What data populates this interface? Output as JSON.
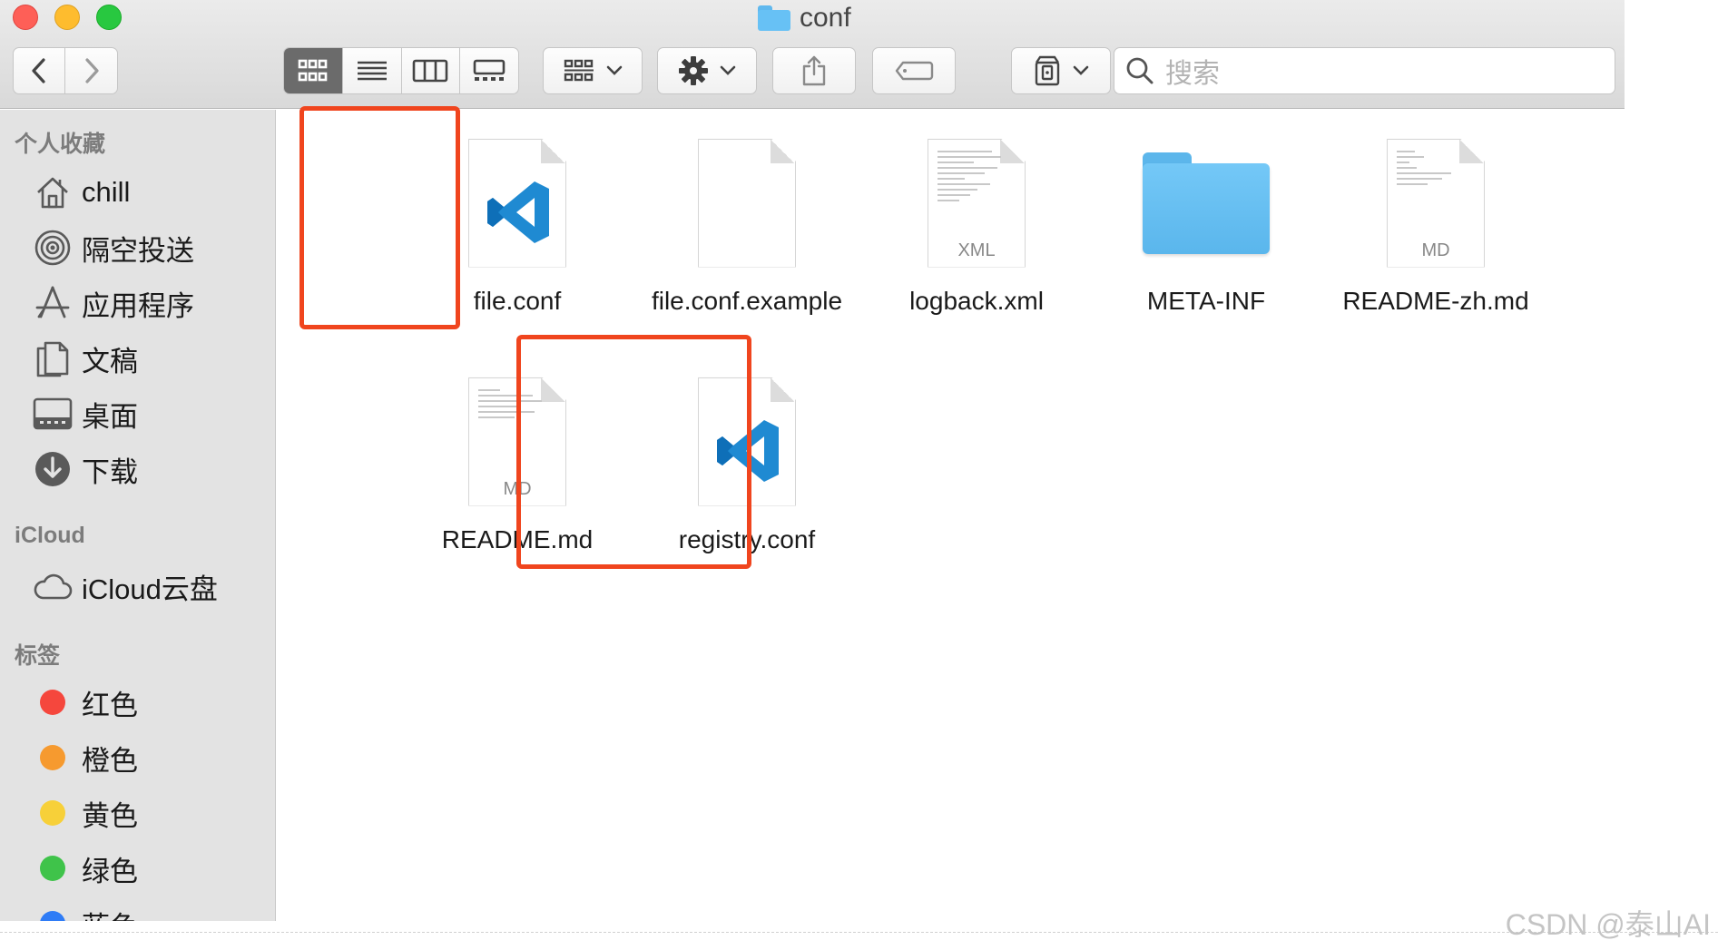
{
  "window": {
    "title": "conf"
  },
  "toolbar": {
    "back_icon": "chevron-left-icon",
    "forward_icon": "chevron-right-icon",
    "view_modes": [
      "icon-view",
      "list-view",
      "column-view",
      "gallery-view"
    ],
    "active_view": "icon-view",
    "search_placeholder": "搜索"
  },
  "sidebar": {
    "favorites_header": "个人收藏",
    "favorites": [
      {
        "label": "chill",
        "icon": "home-icon"
      },
      {
        "label": "隔空投送",
        "icon": "airdrop-icon"
      },
      {
        "label": "应用程序",
        "icon": "applications-icon"
      },
      {
        "label": "文稿",
        "icon": "documents-icon"
      },
      {
        "label": "桌面",
        "icon": "desktop-icon"
      },
      {
        "label": "下载",
        "icon": "download-icon"
      }
    ],
    "icloud_header": "iCloud",
    "icloud": [
      {
        "label": "iCloud云盘",
        "icon": "cloud-icon"
      }
    ],
    "tags_header": "标签",
    "tags": [
      {
        "label": "红色",
        "color": "#f5473d"
      },
      {
        "label": "橙色",
        "color": "#f69a2f"
      },
      {
        "label": "黄色",
        "color": "#f7d039"
      },
      {
        "label": "绿色",
        "color": "#3fc34a"
      },
      {
        "label": "蓝色",
        "color": "#2f7cf6"
      }
    ]
  },
  "files": [
    {
      "name": "file.conf",
      "kind": "vscode",
      "highlighted": true
    },
    {
      "name": "file.conf.example",
      "kind": "blank"
    },
    {
      "name": "logback.xml",
      "kind": "doc",
      "type_label": "XML"
    },
    {
      "name": "META-INF",
      "kind": "folder"
    },
    {
      "name": "README-zh.md",
      "kind": "doc",
      "type_label": "MD"
    },
    {
      "name": "README.md",
      "kind": "doc",
      "type_label": "MD"
    },
    {
      "name": "registry.conf",
      "kind": "vscode",
      "highlighted": true
    }
  ],
  "colors": {
    "highlight": "#f0451e",
    "vscode_blue": "#1f8ad2"
  },
  "watermark": "CSDN @泰山AI"
}
